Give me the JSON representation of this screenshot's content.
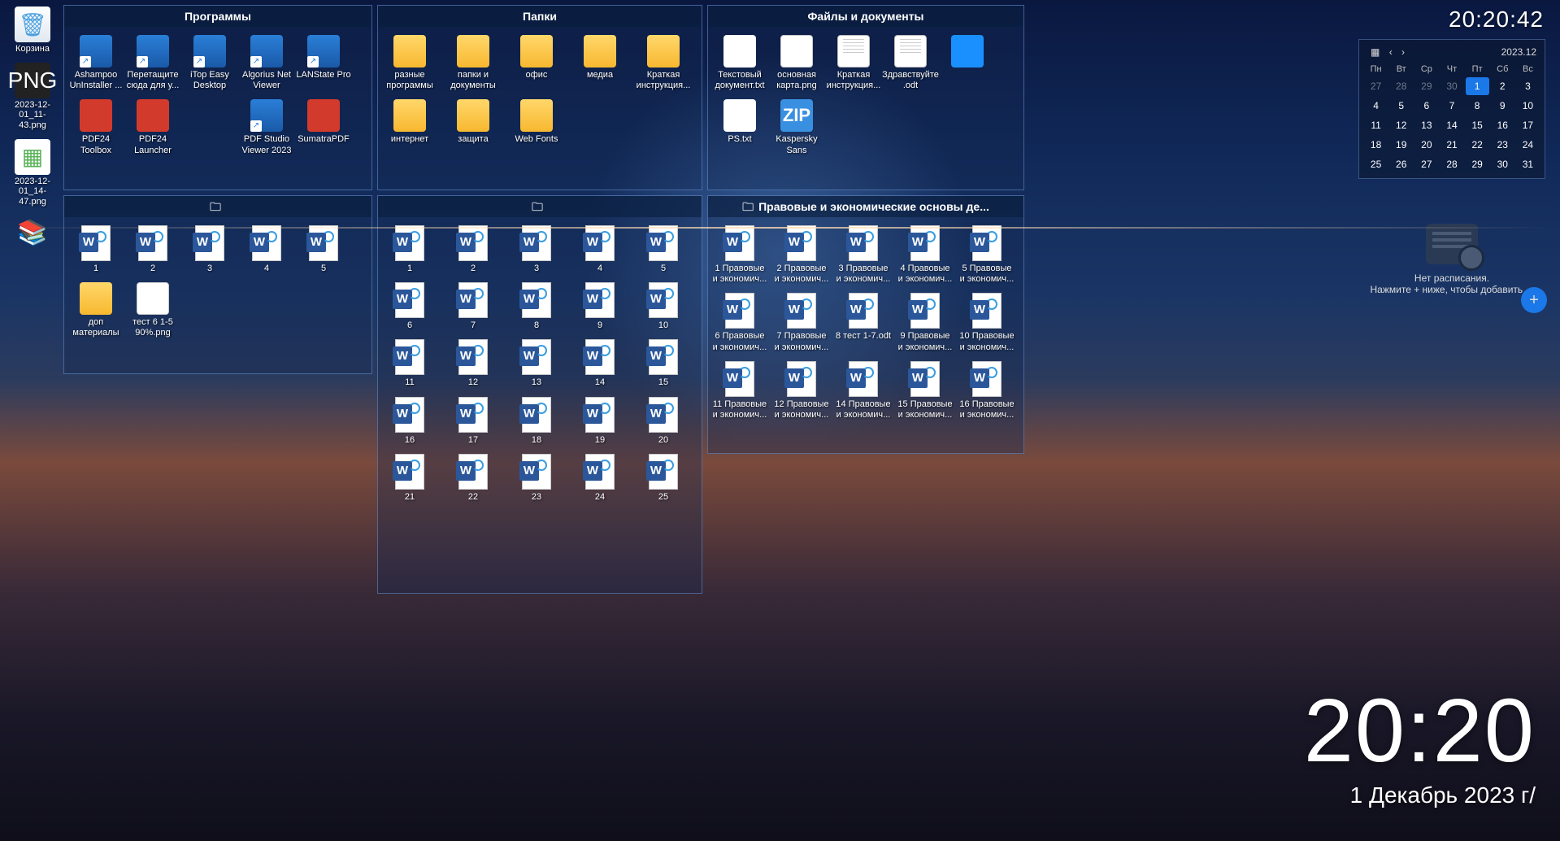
{
  "desktop_left": [
    {
      "label": "Корзина",
      "icon": "recycle"
    },
    {
      "label": "2023-12-01_11-43.png",
      "icon": "png"
    },
    {
      "label": "2023-12-01_14-47.png",
      "icon": "file"
    },
    {
      "label": "",
      "icon": "books"
    }
  ],
  "fences": {
    "programs": {
      "title": "Программы",
      "row1": [
        {
          "label": "Ashampoo UnInstaller ..."
        },
        {
          "label": "Перетащите сюда для у..."
        },
        {
          "label": "iTop Easy Desktop"
        },
        {
          "label": "Algorius Net Viewer"
        },
        {
          "label": "LANState Pro"
        }
      ],
      "row2": [
        {
          "label": "PDF24 Toolbox"
        },
        {
          "label": "PDF24 Launcher"
        },
        {
          "label": "PDF Studio Viewer 2023"
        },
        {
          "label": "SumatraPDF"
        }
      ]
    },
    "folders": {
      "title": "Папки",
      "row1": [
        {
          "label": "разные программы"
        },
        {
          "label": "папки и документы"
        },
        {
          "label": "офис"
        },
        {
          "label": "медиа"
        },
        {
          "label": "Краткая инструкция..."
        }
      ],
      "row2": [
        {
          "label": "интернет"
        },
        {
          "label": "защита"
        },
        {
          "label": "Web Fonts"
        }
      ]
    },
    "files": {
      "title": "Файлы и документы",
      "row1": [
        {
          "label": "Текстовый документ.txt",
          "type": "txt"
        },
        {
          "label": "основная карта.png",
          "type": "png"
        },
        {
          "label": "Краткая инструкция...",
          "type": "doc"
        },
        {
          "label": "Здравствуйте.odt",
          "type": "doc"
        },
        {
          "label": "",
          "type": "mon"
        }
      ],
      "row2": [
        {
          "label": "PS.txt",
          "type": "txt"
        },
        {
          "label": "Kaspersky Sans Regula...",
          "type": "zip"
        }
      ]
    },
    "group_a": {
      "title": " ",
      "row1": [
        "1",
        "2",
        "3",
        "4",
        "5"
      ],
      "extras": [
        {
          "label": "доп материалы",
          "type": "folder"
        },
        {
          "label": "тест 6 1-5 90%.png",
          "type": "png"
        }
      ]
    },
    "group_b": {
      "title": " ",
      "rows": [
        [
          "1",
          "2",
          "3",
          "4",
          "5"
        ],
        [
          "6",
          "7",
          "8",
          "9",
          "10"
        ],
        [
          "11",
          "12",
          "13",
          "14",
          "15"
        ],
        [
          "16",
          "17",
          "18",
          "19",
          "20"
        ],
        [
          "21",
          "22",
          "23",
          "24",
          "25"
        ]
      ]
    },
    "legal": {
      "title": "Правовые и экономические основы де...",
      "row1": [
        "1 Правовые и экономич...",
        "2 Правовые и экономич...",
        "3 Правовые и экономич...",
        "4 Правовые и экономич...",
        "5 Правовые и экономич..."
      ],
      "row2": [
        "6 Правовые и экономич...",
        "7 Правовые и экономич...",
        "8 тест 1-7.odt",
        "9 Правовые и экономич...",
        "10 Правовые и экономич..."
      ],
      "row3": [
        "11 Правовые и экономич...",
        "12 Правовые и экономич...",
        "14 Правовые и экономич...",
        "15 Правовые и экономич...",
        "16 Правовые и экономич..."
      ]
    }
  },
  "widgets": {
    "clock_top": "20:20:42",
    "calendar": {
      "period": "2023.12",
      "dow": [
        "Пн",
        "Вт",
        "Ср",
        "Чт",
        "Пт",
        "Сб",
        "Вс"
      ],
      "prev_days": [
        27,
        28,
        29,
        30
      ],
      "days": [
        1,
        2,
        3,
        4,
        5,
        6,
        7,
        8,
        9,
        10,
        11,
        12,
        13,
        14,
        15,
        16,
        17,
        18,
        19,
        20,
        21,
        22,
        23,
        24,
        25,
        26,
        27,
        28,
        29,
        30,
        31
      ],
      "selected": 1
    },
    "schedule": {
      "text1": "Нет расписания.",
      "text2": "Нажмите + ниже, чтобы добавить ..."
    },
    "big_time": "20:20",
    "big_date": "1 Декабрь 2023 г/"
  }
}
